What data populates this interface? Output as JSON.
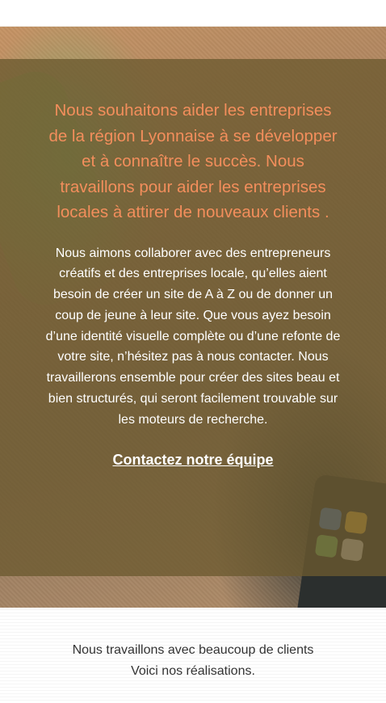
{
  "hero": {
    "headline": "Nous souhaitons aider les entreprises de la région Lyonnaise à se développer et à connaître le succès. Nous travaillons pour aider les entreprises locales à attirer de nouveaux clients .",
    "body": "Nous aimons collaborer avec des entrepreneurs créatifs et des entreprises locale, qu’elles aient besoin de créer un site de A à Z ou de donner un coup de jeune à leur site. Que vous ayez besoin d’une identité visuelle complète ou d’une refonte de votre site, n’hésitez pas à nous contacter. Nous travaillerons ensemble pour créer des sites beau et bien structurés, qui seront facilement trouvable sur les moteurs de recherche.",
    "cta_label": "Contactez notre équipe"
  },
  "clients": {
    "line1": "Nous travaillons avec beaucoup de clients",
    "line2": "Voici nos réalisations."
  },
  "colors": {
    "accent": "#f38e5c",
    "overlay": "#6b5a30"
  }
}
